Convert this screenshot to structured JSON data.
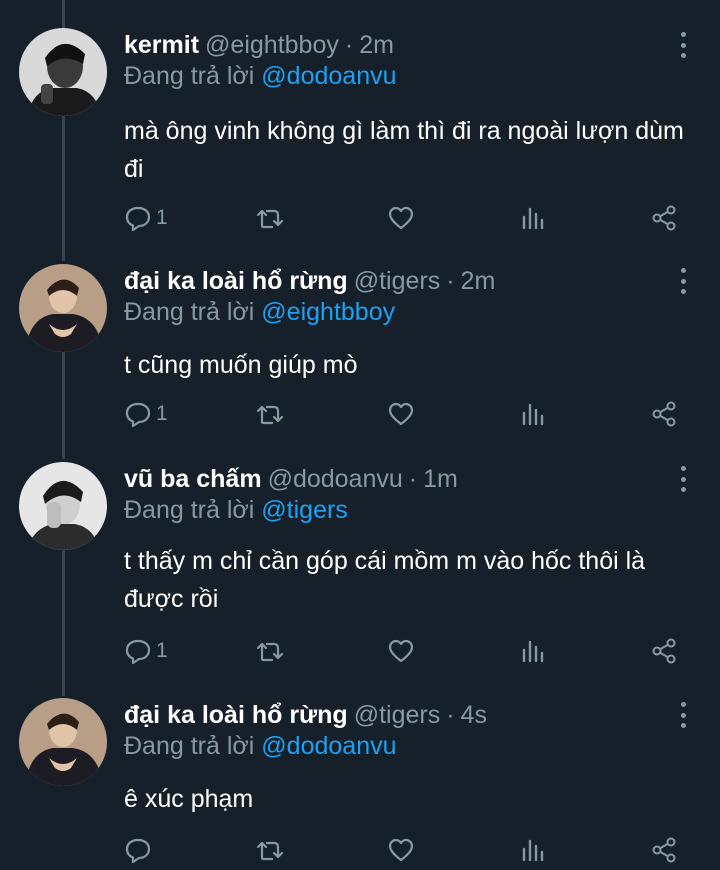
{
  "thread": {
    "tweets": [
      {
        "display_name": "kermit",
        "handle": "@eightbboy",
        "separator": "·",
        "time": "2m",
        "replying_prefix": "Đang trả lời",
        "replying_to": "@dodoanvu",
        "text": "mà ông vinh không gì làm thì đi ra ngoài lượn dùm đi",
        "reply_count": "1",
        "avatar_icon": "avatar-kermit"
      },
      {
        "display_name": "đại ka loài hổ rừng",
        "handle": "@tigers",
        "separator": "·",
        "time": "2m",
        "replying_prefix": "Đang trả lời",
        "replying_to": "@eightbboy",
        "text": "t cũng muốn giúp mò",
        "reply_count": "1",
        "avatar_icon": "avatar-tigers"
      },
      {
        "display_name": "vũ ba chấm",
        "handle": "@dodoanvu",
        "separator": "·",
        "time": "1m",
        "replying_prefix": "Đang trả lời",
        "replying_to": "@tigers",
        "text": "t thấy m chỉ cần góp cái mồm m vào hốc thôi là được rồi",
        "reply_count": "1",
        "avatar_icon": "avatar-dodoanvu"
      },
      {
        "display_name": "đại ka loài hổ rừng",
        "handle": "@tigers",
        "separator": "·",
        "time": "4s",
        "replying_prefix": "Đang trả lời",
        "replying_to": "@dodoanvu",
        "text": "ê xúc phạm",
        "reply_count": "",
        "avatar_icon": "avatar-tigers"
      }
    ]
  },
  "icons": [
    "reply-icon",
    "retweet-icon",
    "like-icon",
    "analytics-icon",
    "share-icon",
    "more-icon"
  ],
  "colors": {
    "background": "#15202b",
    "text": "#ffffff",
    "secondary": "#8899a6",
    "accent": "#1da1f2",
    "thread_line": "#38444d"
  }
}
